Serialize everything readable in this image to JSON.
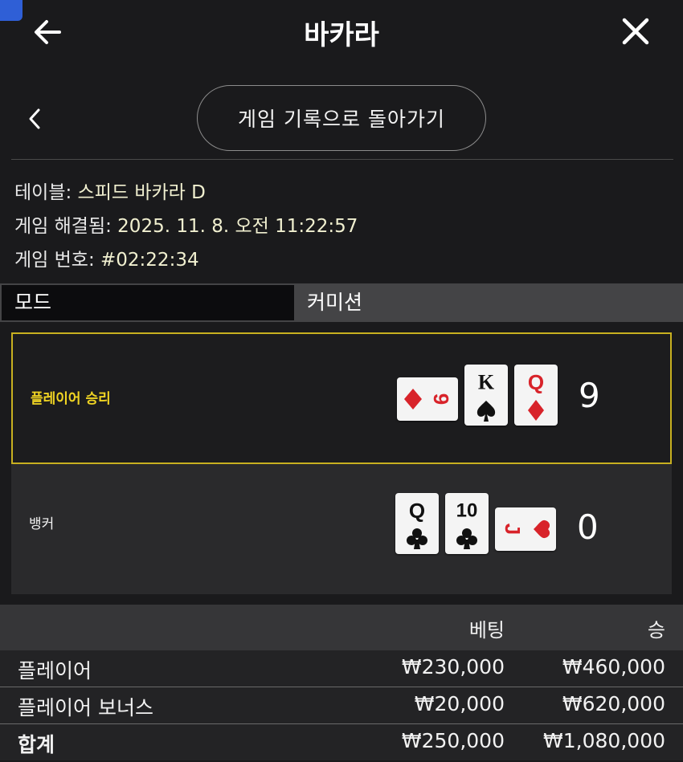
{
  "header": {
    "title": "바카라"
  },
  "nav": {
    "back_record_label": "게임 기록으로 돌아가기"
  },
  "info": {
    "table_label": "테이블: ",
    "table_value": "스피드 바카라 D",
    "resolved_label": "게임 해결됨: ",
    "resolved_value": "2025. 11. 8. 오전 11:22:57",
    "number_label": "게임 번호: ",
    "number_value": "#02:22:34"
  },
  "mode": {
    "mode_label": "모드",
    "mode_value": "커미션"
  },
  "results": {
    "player": {
      "label": "플레이어 승리",
      "score": "9",
      "cards": [
        {
          "rank": "9",
          "suit": "diamond",
          "rotated": true
        },
        {
          "rank": "K",
          "suit": "spade",
          "rotated": false
        },
        {
          "rank": "Q",
          "suit": "diamond",
          "rotated": false
        }
      ]
    },
    "banker": {
      "label": "뱅커",
      "score": "0",
      "cards": [
        {
          "rank": "Q",
          "suit": "club",
          "rotated": false
        },
        {
          "rank": "10",
          "suit": "club",
          "rotated": false
        },
        {
          "rank": "J",
          "suit": "heart",
          "rotated": true
        }
      ]
    }
  },
  "bets": {
    "header_bet": "베팅",
    "header_win": "승",
    "rows": [
      {
        "label": "플레이어",
        "bet": "₩230,000",
        "win": "₩460,000"
      },
      {
        "label": "플레이어 보너스",
        "bet": "₩20,000",
        "win": "₩620,000"
      },
      {
        "label": "합계",
        "bet": "₩250,000",
        "win": "₩1,080,000"
      }
    ]
  },
  "colors": {
    "accent_yellow": "#f0d423",
    "card_red": "#d8232a",
    "background": "#1a1a1c"
  },
  "icons": {
    "back": "arrow-left-icon",
    "close": "close-icon",
    "prev": "chevron-left-icon"
  }
}
